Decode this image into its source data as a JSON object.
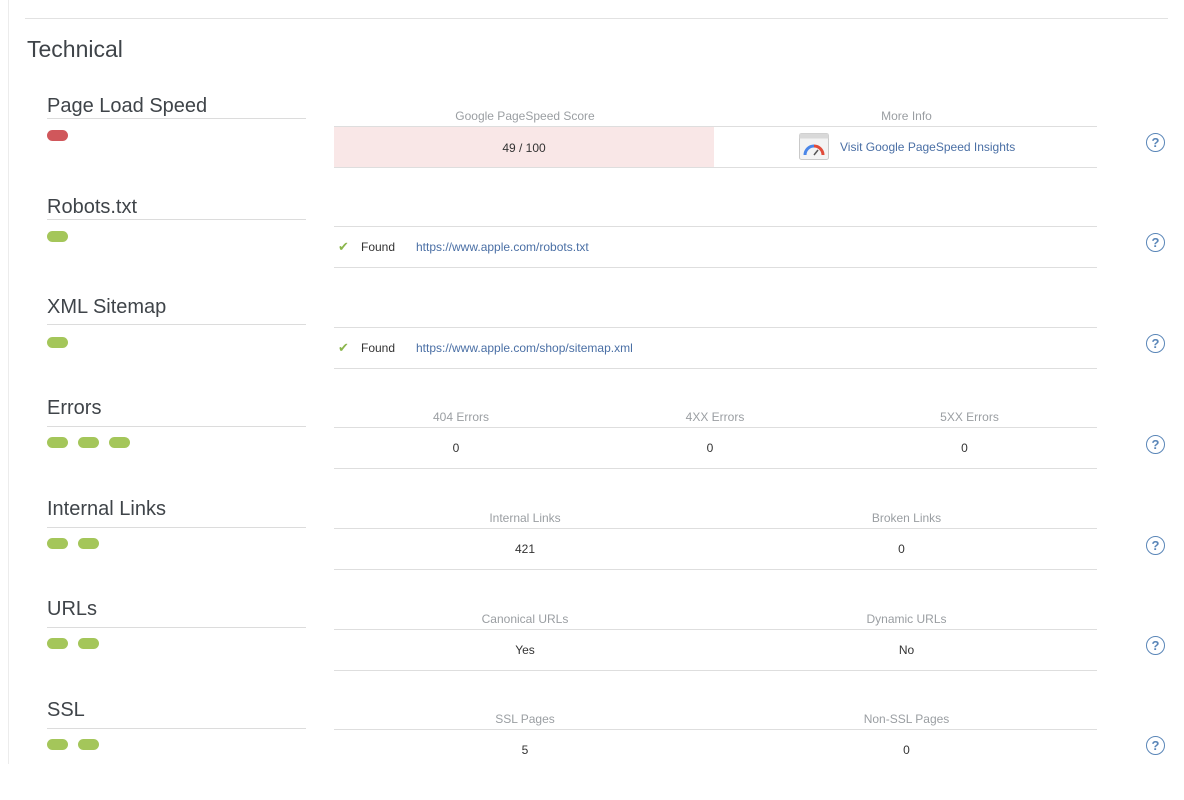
{
  "section_title": "Technical",
  "rows": {
    "page_load": {
      "title": "Page Load Speed",
      "header_score": "Google PageSpeed Score",
      "header_info": "More Info",
      "score": "49 / 100",
      "link": "Visit Google PageSpeed Insights",
      "pill_colors": [
        "#d0575b"
      ]
    },
    "robots": {
      "title": "Robots.txt",
      "status": "Found",
      "url": "https://www.apple.com/robots.txt"
    },
    "sitemap": {
      "title": "XML Sitemap",
      "status": "Found",
      "url": "https://www.apple.com/shop/sitemap.xml"
    },
    "errors": {
      "title": "Errors",
      "headers": [
        "404 Errors",
        "4XX Errors",
        "5XX Errors"
      ],
      "values": [
        "0",
        "0",
        "0"
      ]
    },
    "internal_links": {
      "title": "Internal Links",
      "headers": [
        "Internal Links",
        "Broken Links"
      ],
      "values": [
        "421",
        "0"
      ]
    },
    "urls": {
      "title": "URLs",
      "headers": [
        "Canonical URLs",
        "Dynamic URLs"
      ],
      "values": [
        "Yes",
        "No"
      ]
    },
    "ssl": {
      "title": "SSL",
      "headers": [
        "SSL Pages",
        "Non-SSL Pages"
      ],
      "values": [
        "5",
        "0"
      ]
    }
  },
  "help_label": "?",
  "check_glyph": "✔",
  "colors": {
    "green": "#a4c65a",
    "red": "#d0575b",
    "link": "#4a6fa5",
    "score_bg": "#f9e7e7"
  }
}
